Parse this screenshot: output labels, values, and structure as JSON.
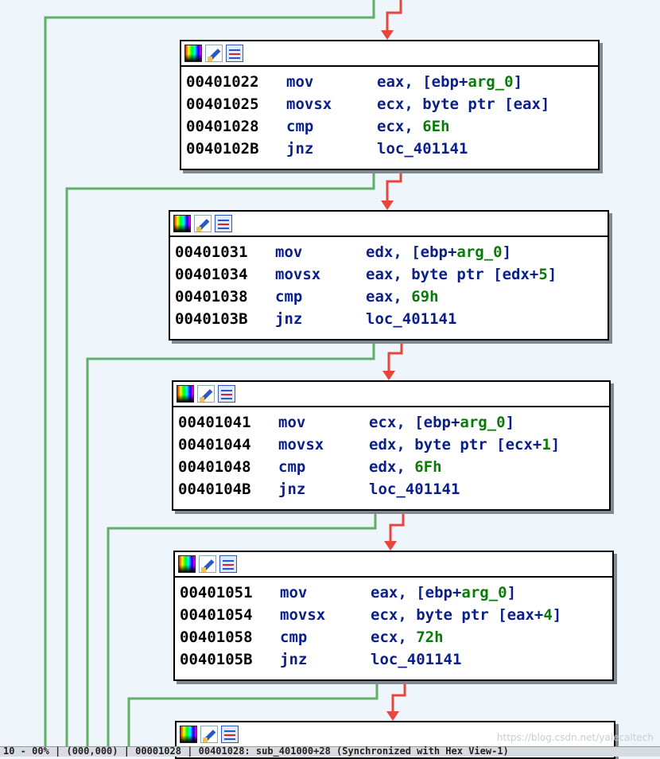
{
  "blocks": [
    {
      "id": "b1",
      "lines": [
        {
          "addr": "00401022",
          "mnem": "mov",
          "ops": [
            {
              "t": "eax, [ebp+",
              "c": "r"
            },
            {
              "t": "arg_0",
              "c": "v"
            },
            {
              "t": "]",
              "c": "r"
            }
          ]
        },
        {
          "addr": "00401025",
          "mnem": "movsx",
          "ops": [
            {
              "t": "ecx, byte ptr [eax]",
              "c": "r"
            }
          ]
        },
        {
          "addr": "00401028",
          "mnem": "cmp",
          "ops": [
            {
              "t": "ecx, ",
              "c": "r"
            },
            {
              "t": "6Eh",
              "c": "n"
            }
          ]
        },
        {
          "addr": "0040102B",
          "mnem": "jnz",
          "ops": [
            {
              "t": "loc_401141",
              "c": "r"
            }
          ]
        }
      ]
    },
    {
      "id": "b2",
      "lines": [
        {
          "addr": "00401031",
          "mnem": "mov",
          "ops": [
            {
              "t": "edx, [ebp+",
              "c": "r"
            },
            {
              "t": "arg_0",
              "c": "v"
            },
            {
              "t": "]",
              "c": "r"
            }
          ]
        },
        {
          "addr": "00401034",
          "mnem": "movsx",
          "ops": [
            {
              "t": "eax, byte ptr [edx+",
              "c": "r"
            },
            {
              "t": "5",
              "c": "n"
            },
            {
              "t": "]",
              "c": "r"
            }
          ]
        },
        {
          "addr": "00401038",
          "mnem": "cmp",
          "ops": [
            {
              "t": "eax, ",
              "c": "r"
            },
            {
              "t": "69h",
              "c": "n"
            }
          ]
        },
        {
          "addr": "0040103B",
          "mnem": "jnz",
          "ops": [
            {
              "t": "loc_401141",
              "c": "r"
            }
          ]
        }
      ]
    },
    {
      "id": "b3",
      "lines": [
        {
          "addr": "00401041",
          "mnem": "mov",
          "ops": [
            {
              "t": "ecx, [ebp+",
              "c": "r"
            },
            {
              "t": "arg_0",
              "c": "v"
            },
            {
              "t": "]",
              "c": "r"
            }
          ]
        },
        {
          "addr": "00401044",
          "mnem": "movsx",
          "ops": [
            {
              "t": "edx, byte ptr [ecx+",
              "c": "r"
            },
            {
              "t": "1",
              "c": "n"
            },
            {
              "t": "]",
              "c": "r"
            }
          ]
        },
        {
          "addr": "00401048",
          "mnem": "cmp",
          "ops": [
            {
              "t": "edx, ",
              "c": "r"
            },
            {
              "t": "6Fh",
              "c": "n"
            }
          ]
        },
        {
          "addr": "0040104B",
          "mnem": "jnz",
          "ops": [
            {
              "t": "loc_401141",
              "c": "r"
            }
          ]
        }
      ]
    },
    {
      "id": "b4",
      "lines": [
        {
          "addr": "00401051",
          "mnem": "mov",
          "ops": [
            {
              "t": "eax, [ebp+",
              "c": "r"
            },
            {
              "t": "arg_0",
              "c": "v"
            },
            {
              "t": "]",
              "c": "r"
            }
          ]
        },
        {
          "addr": "00401054",
          "mnem": "movsx",
          "ops": [
            {
              "t": "ecx, byte ptr [eax+",
              "c": "r"
            },
            {
              "t": "4",
              "c": "n"
            },
            {
              "t": "]",
              "c": "r"
            }
          ]
        },
        {
          "addr": "00401058",
          "mnem": "cmp",
          "ops": [
            {
              "t": "ecx, ",
              "c": "r"
            },
            {
              "t": "72h",
              "c": "n"
            }
          ]
        },
        {
          "addr": "0040105B",
          "mnem": "jnz",
          "ops": [
            {
              "t": "loc_401141",
              "c": "r"
            }
          ]
        }
      ]
    },
    {
      "id": "b5",
      "lines": []
    }
  ],
  "icons": [
    "color-palette-icon",
    "edit-pencil-icon",
    "graph-view-icon"
  ],
  "colors": {
    "true_edge": "#e8453c",
    "false_edge": "#5fae6a",
    "addr": "#000000",
    "mnemonic": "#0b1f8a",
    "var": "#0a7a0a"
  },
  "watermark": "https://blog.csdn.net/yalecaltech",
  "status": {
    "text": "10 - 00% | (000,000) | 00001028 | 00401028: sub_401000+28 (Synchronized with Hex View-1)"
  }
}
